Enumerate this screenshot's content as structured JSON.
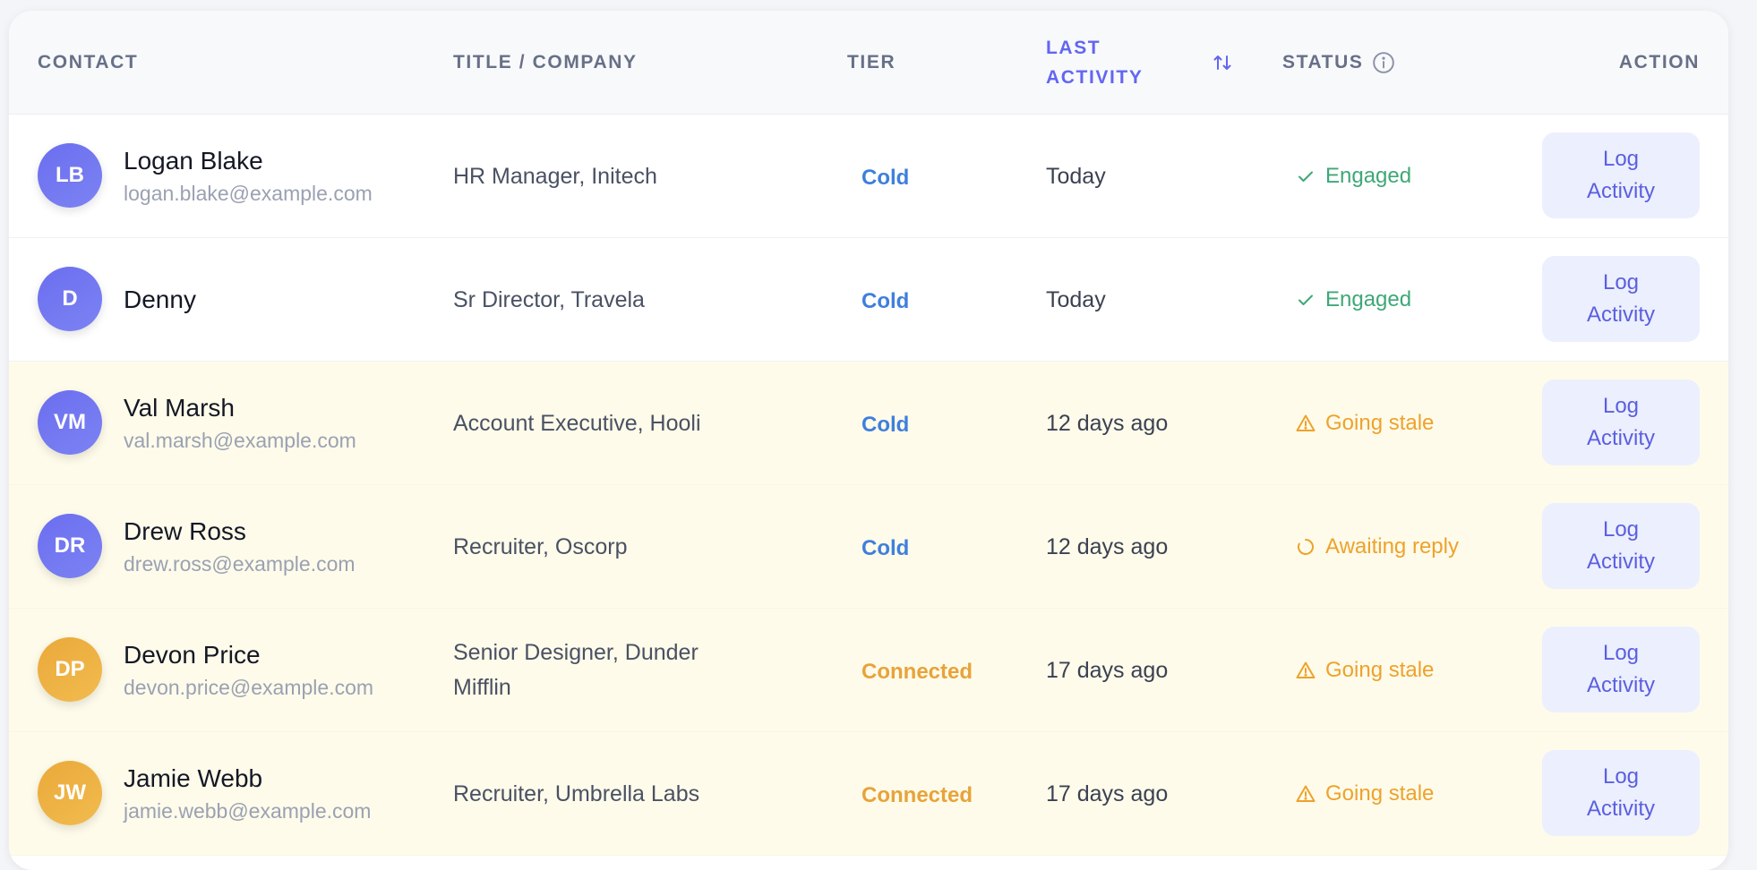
{
  "colors": {
    "accent": "#6366f1",
    "engaged": "#3ea877",
    "warning": "#eea22c",
    "cold": "#3f7fdc",
    "connected": "#e8a33a",
    "stale_row_bg": "#fefbea"
  },
  "table": {
    "headers": {
      "contact": "Contact",
      "title_company": "Title / Company",
      "tier": "Tier",
      "last_activity_line1": "Last",
      "last_activity_line2": "Activity",
      "status": "Status",
      "action": "Action"
    },
    "header_icons": {
      "sort": "sort-arrows-icon",
      "info": "info-icon"
    },
    "rows": [
      {
        "initials": "LB",
        "avatar_color": "indigo",
        "name": "Logan Blake",
        "email": "logan.blake@example.com",
        "title": "HR Manager, Initech",
        "tier": "Cold",
        "last_activity": "Today",
        "status": "Engaged",
        "status_icon": "check-icon",
        "action": "Log Activity"
      },
      {
        "initials": "D",
        "avatar_color": "indigo",
        "name": "Denny",
        "email": "",
        "title": "Sr Director, Travela",
        "tier": "Cold",
        "last_activity": "Today",
        "status": "Engaged",
        "status_icon": "check-icon",
        "action": "Log Activity"
      },
      {
        "initials": "VM",
        "avatar_color": "indigo",
        "name": "Val Marsh",
        "email": "val.marsh@example.com",
        "title": "Account Executive, Hooli",
        "tier": "Cold",
        "last_activity": "12 days ago",
        "status": "Going stale",
        "status_icon": "warning-icon",
        "action": "Log Activity"
      },
      {
        "initials": "DR",
        "avatar_color": "indigo",
        "name": "Drew Ross",
        "email": "drew.ross@example.com",
        "title": "Recruiter, Oscorp",
        "tier": "Cold",
        "last_activity": "12 days ago",
        "status": "Awaiting reply",
        "status_icon": "loading-icon",
        "action": "Log Activity"
      },
      {
        "initials": "DP",
        "avatar_color": "amber",
        "name": "Devon Price",
        "email": "devon.price@example.com",
        "title": "Senior Designer, Dunder Mifflin",
        "tier": "Connected",
        "last_activity": "17 days ago",
        "status": "Going stale",
        "status_icon": "warning-icon",
        "action": "Log Activity"
      },
      {
        "initials": "JW",
        "avatar_color": "amber",
        "name": "Jamie Webb",
        "email": "jamie.webb@example.com",
        "title": "Recruiter, Umbrella Labs",
        "tier": "Connected",
        "last_activity": "17 days ago",
        "status": "Going stale",
        "status_icon": "warning-icon",
        "action": "Log Activity"
      }
    ]
  }
}
